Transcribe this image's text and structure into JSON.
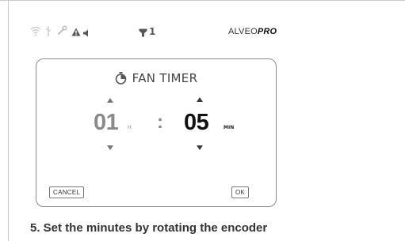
{
  "status_bar": {
    "icons": [
      "wifi-icon",
      "usb-icon",
      "wrench-icon",
      "alert-icon",
      "mute-icon",
      "filter-icon"
    ],
    "filter_count": "1",
    "brand_prefix": "ALVEO",
    "brand_suffix": "PRO"
  },
  "timer": {
    "title": "FAN TIMER",
    "hours": "01",
    "hours_unit": "H",
    "separator": ":",
    "minutes": "05",
    "minutes_unit": "MIN",
    "cancel_label": "CANCEL",
    "ok_label": "OK"
  },
  "caption": "5. Set the minutes by rotating the encoder",
  "colors": {
    "active_value": "#111111",
    "inactive_value": "#8a8a8a",
    "border": "#8c8c8c"
  }
}
